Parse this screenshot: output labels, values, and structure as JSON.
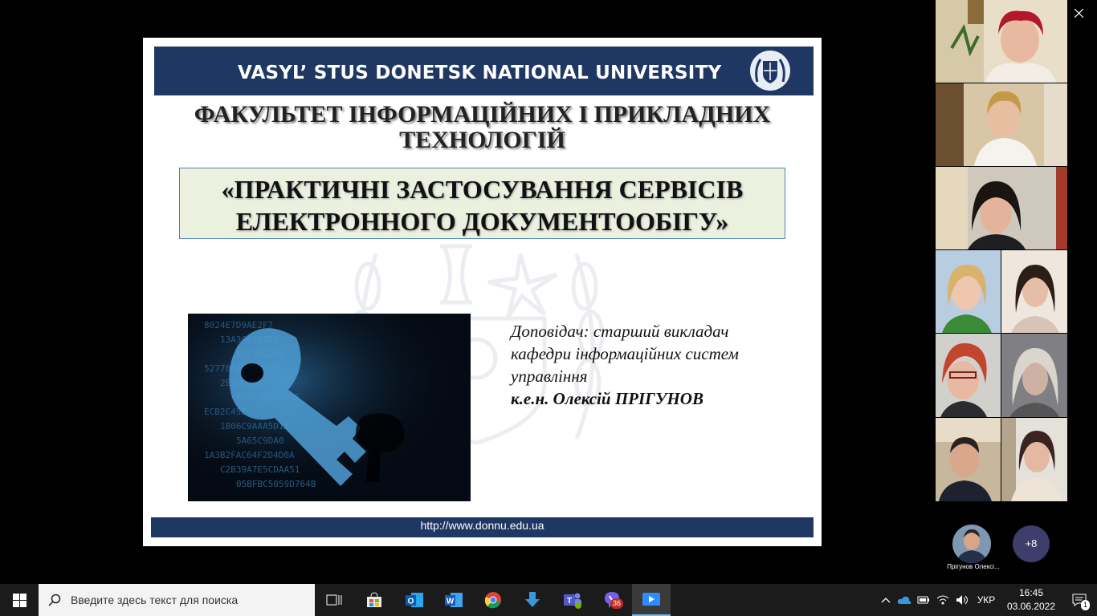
{
  "slide": {
    "university": "VASYL’ STUS DONETSK NATIONAL UNIVERSITY",
    "faculty_line1": "ФАКУЛЬТЕТ ІНФОРМАЦІЙНИХ І ПРИКЛАДНИХ",
    "faculty_line2": "ТЕХНОЛОГІЙ",
    "topic_line1": "«ПРАКТИЧНІ ЗАСТОСУВАННЯ СЕРВІСІВ",
    "topic_line2": "ЕЛЕКТРОННОГО ДОКУМЕНТООБІГУ»",
    "speaker_line1": "Доповідач: старший викладач",
    "speaker_line2": "кафедри інформаційних систем",
    "speaker_line3": "управління",
    "speaker_name": "к.е.н. Олексій ПРІГУНОВ",
    "footer_url": "http://www.donnu.edu.ua",
    "key_code_lines": [
      "8024E7D9AE2F7",
      "13A3C4169DB",
      "E5F2082D0",
      "52770F1647747B",
      "2B70DDA4",
      "0C2C3DD8031E",
      "ECB2C45E",
      "1B06C9AAA5D1A",
      "5A65C9DA0",
      "1A3B2FAC64F2D4D0A",
      "C2B39A7E5CDAA51",
      "05BFBC5059D764B"
    ]
  },
  "participants": {
    "more_count": "+8",
    "presenter_label": "Прігунов Олексі..."
  },
  "taskbar": {
    "search_placeholder": "Введите здесь текст для поиска",
    "viber_badge": "36",
    "language": "УКР",
    "time": "16:45",
    "date": "03.06.2022",
    "notification_count": "1"
  },
  "colors": {
    "slide_header": "#1f3763",
    "topic_box": "#ebf1de",
    "taskbar": "#1b1b1b",
    "more_button": "#3e3d6b"
  }
}
